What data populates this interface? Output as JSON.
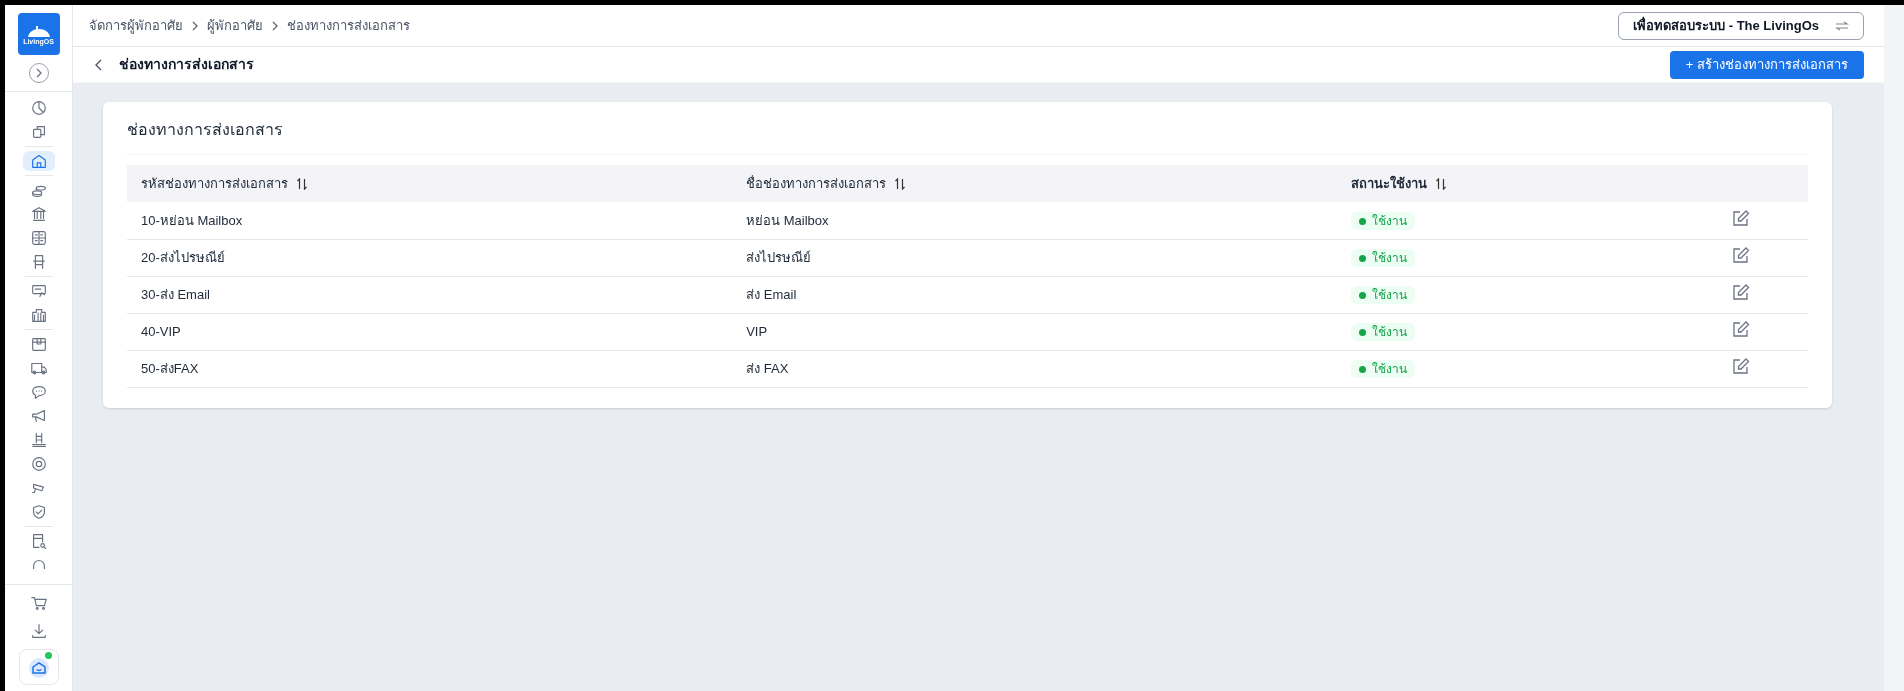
{
  "breadcrumb": [
    "จัดการผู้พักอาศัย",
    "ผู้พักอาศัย",
    "ช่องทางการส่งเอกสาร"
  ],
  "project_switcher": {
    "label": "เพื่อทดสอบระบบ - The LivingOs"
  },
  "logo": {
    "text": "LivingOS"
  },
  "page": {
    "title": "ช่องทางการส่งเอกสาร",
    "create_button": "+ สร้างช่องทางการส่งเอกสาร"
  },
  "sidebar": {
    "groups": [
      [
        {
          "selected": false
        },
        {
          "selected": false
        }
      ],
      [
        {
          "selected": true
        }
      ],
      [
        {
          "selected": false
        },
        {
          "selected": false
        },
        {
          "selected": false
        },
        {
          "selected": false
        }
      ],
      [
        {
          "selected": false
        },
        {
          "selected": false
        }
      ],
      [
        {
          "selected": false
        },
        {
          "selected": false
        },
        {
          "selected": false
        },
        {
          "selected": false
        },
        {
          "selected": false
        },
        {
          "selected": false
        },
        {
          "selected": false
        },
        {
          "selected": false
        }
      ],
      [
        {
          "selected": false
        },
        {
          "selected": false
        }
      ]
    ],
    "bottom": [
      {
        "selected": false
      },
      {
        "selected": false
      }
    ],
    "assistant": {
      "online": true
    }
  },
  "card": {
    "title": "ช่องทางการส่งเอกสาร"
  },
  "table": {
    "columns": [
      "รหัสช่องทางการส่งเอกสาร",
      "ชื่อช่องทางการส่งเอกสาร",
      "สถานะใช้งาน"
    ],
    "rows": [
      {
        "code": "10-หย่อน Mailbox",
        "name": "หย่อน Mailbox",
        "status": "ใช้งาน",
        "active": true
      },
      {
        "code": "20-ส่งไปรษณีย์",
        "name": "ส่งไปรษณีย์",
        "status": "ใช้งาน",
        "active": true
      },
      {
        "code": "30-ส่ง Email",
        "name": "ส่ง Email",
        "status": "ใช้งาน",
        "active": true
      },
      {
        "code": "40-VIP",
        "name": "VIP",
        "status": "ใช้งาน",
        "active": true
      },
      {
        "code": "50-ส่งFAX",
        "name": "ส่ง FAX",
        "status": "ใช้งาน",
        "active": true
      }
    ]
  }
}
